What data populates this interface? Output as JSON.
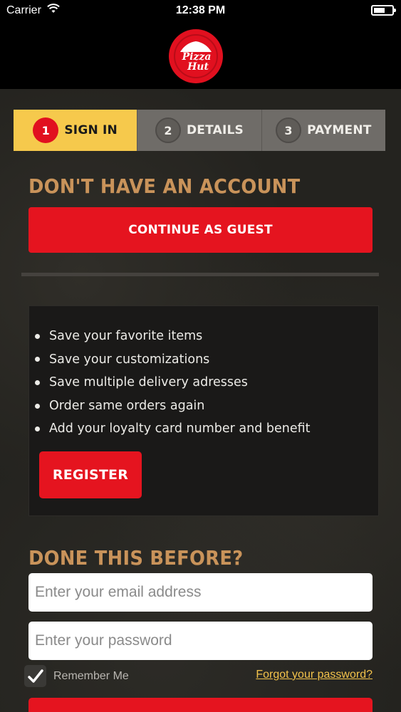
{
  "status_bar": {
    "carrier": "Carrier",
    "time": "12:38 PM"
  },
  "header": {
    "logo_text_line1": "Pizza",
    "logo_text_line2": "Hut"
  },
  "steps": [
    {
      "number": "1",
      "label": "SIGN IN",
      "active": true
    },
    {
      "number": "2",
      "label": "DETAILS",
      "active": false
    },
    {
      "number": "3",
      "label": "PAYMENT",
      "active": false
    }
  ],
  "guest_section": {
    "title": "DON'T HAVE AN ACCOUNT",
    "continue_button": "CONTINUE AS GUEST"
  },
  "benefits": [
    "Save your favorite items",
    "Save your customizations",
    "Save multiple delivery adresses",
    "Order same orders again",
    "Add your loyalty card number and benefit"
  ],
  "register_button": "REGISTER",
  "login_section": {
    "title": "DONE THIS BEFORE?",
    "email_placeholder": "Enter your email address",
    "password_placeholder": "Enter your password",
    "remember_label": "Remember Me",
    "remember_checked": true,
    "forgot_link": "Forgot your password?"
  },
  "colors": {
    "accent_red": "#e5141f",
    "step_active": "#f6c94c",
    "step_inactive": "#6f6c68",
    "section_title": "#c9935a",
    "link": "#f3c34b"
  }
}
